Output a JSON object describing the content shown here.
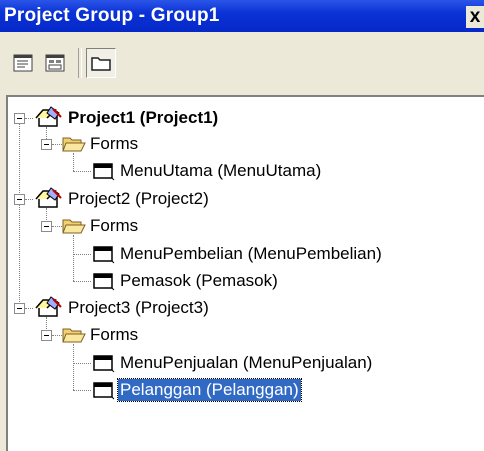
{
  "window": {
    "title": "Project Group - Group1",
    "close_glyph": "x"
  },
  "toolbar": {
    "buttons": [
      {
        "icon": "view-code-icon"
      },
      {
        "icon": "view-object-icon"
      },
      {
        "icon": "toggle-folders-icon",
        "pressed": true
      }
    ]
  },
  "tree": {
    "projects": [
      {
        "label": "Project1 (Project1)",
        "bold": true,
        "folder": "Forms",
        "forms": [
          "MenuUtama (MenuUtama)"
        ]
      },
      {
        "label": "Project2 (Project2)",
        "bold": false,
        "folder": "Forms",
        "forms": [
          "MenuPembelian (MenuPembelian)",
          "Pemasok (Pemasok)"
        ]
      },
      {
        "label": "Project3 (Project3)",
        "bold": false,
        "folder": "Forms",
        "forms": [
          "MenuPenjualan (MenuPenjualan)",
          "Pelanggan (Pelanggan)"
        ]
      }
    ],
    "selected_item": "Pelanggan (Pelanggan)"
  },
  "colors": {
    "title_bar": "#0a32d6",
    "selection": "#316ac5",
    "window_bg": "#ece9d8"
  }
}
